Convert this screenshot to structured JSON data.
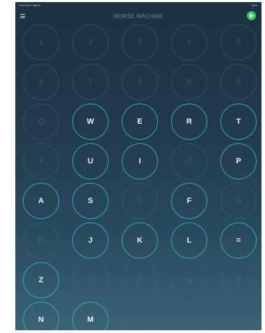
{
  "status_bar": {
    "left": "7:54 PM  Fri Mar 8",
    "right": "64%"
  },
  "header": {
    "title": "MORSE MACHINE",
    "menu_icon": "menu-icon",
    "play_icon": "play-icon"
  },
  "colors": {
    "accent": "#2fb0b2",
    "play": "#2fd05a",
    "background": "#21394b"
  },
  "keys": [
    [
      {
        "label": "1",
        "active": false
      },
      {
        "label": "2",
        "active": false
      },
      {
        "label": "3",
        "active": false
      },
      {
        "label": "4",
        "active": false
      },
      {
        "label": "5",
        "active": false
      }
    ],
    [
      {
        "label": "6",
        "active": false
      },
      {
        "label": "7",
        "active": false
      },
      {
        "label": "8",
        "active": false
      },
      {
        "label": "9",
        "active": false
      },
      {
        "label": "0",
        "active": false
      }
    ],
    [
      {
        "label": "Q",
        "active": false
      },
      {
        "label": "W",
        "active": true
      },
      {
        "label": "E",
        "active": true
      },
      {
        "label": "R",
        "active": true
      },
      {
        "label": "T",
        "active": true
      }
    ],
    [
      {
        "label": "Y",
        "active": false
      },
      {
        "label": "U",
        "active": true
      },
      {
        "label": "I",
        "active": true
      },
      {
        "label": "O",
        "active": false
      },
      {
        "label": "P",
        "active": true
      }
    ],
    [
      {
        "label": "A",
        "active": true
      },
      {
        "label": "S",
        "active": true
      },
      {
        "label": "D",
        "active": false
      },
      {
        "label": "F",
        "active": true
      },
      {
        "label": "G",
        "active": false
      }
    ],
    [
      {
        "label": "H",
        "active": false
      },
      {
        "label": "J",
        "active": true
      },
      {
        "label": "K",
        "active": true
      },
      {
        "label": "L",
        "active": true
      },
      {
        "label": "=",
        "active": true
      }
    ],
    [
      {
        "label": "Z",
        "active": true
      },
      {
        "label": "X",
        "active": false
      },
      {
        "label": "C",
        "active": false
      },
      {
        "label": "V",
        "active": false
      },
      {
        "label": "B",
        "active": false
      }
    ],
    [
      {
        "label": "N",
        "active": true
      },
      {
        "label": "M",
        "active": true
      },
      {
        "label": ".",
        "active": false
      },
      {
        "label": "/",
        "active": false
      },
      {
        "label": "?",
        "active": false
      }
    ]
  ]
}
